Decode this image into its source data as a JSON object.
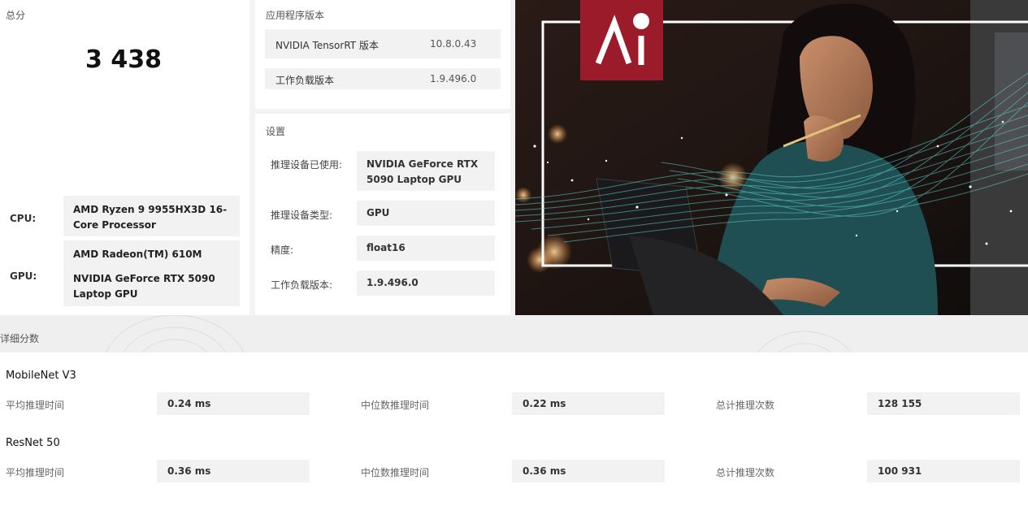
{
  "score": {
    "title": "总分",
    "value": "3 438",
    "cpu_label": "CPU:",
    "cpu_value": "AMD Ryzen 9 9955HX3D 16-Core Processor",
    "gpu_label": "GPU:",
    "gpu_values": [
      "AMD Radeon(TM) 610M",
      "NVIDIA GeForce RTX 5090 Laptop GPU"
    ]
  },
  "app_version": {
    "title": "应用程序版本",
    "rows": [
      {
        "key": "NVIDIA TensorRT 版本",
        "value": "10.8.0.43"
      },
      {
        "key": "工作负载版本",
        "value": "1.9.496.0"
      }
    ]
  },
  "settings": {
    "title": "设置",
    "rows": [
      {
        "key": "推理设备已使用:",
        "value": "NVIDIA GeForce RTX 5090 Laptop GPU"
      },
      {
        "key": "推理设备类型:",
        "value": "GPU"
      },
      {
        "key": "精度:",
        "value": "float16"
      },
      {
        "key": "工作负载版本:",
        "value": "1.9.496.0"
      }
    ]
  },
  "hero": {
    "logo_icon": "ai-logo-icon",
    "brand_color": "#9b1b2b"
  },
  "details": {
    "title": "详细分数",
    "models": [
      {
        "name": "MobileNet V3",
        "avg_label": "平均推理时间",
        "avg_value": "0.24 ms",
        "median_label": "中位数推理时间",
        "median_value": "0.22 ms",
        "count_label": "总计推理次数",
        "count_value": "128 155"
      },
      {
        "name": "ResNet 50",
        "avg_label": "平均推理时间",
        "avg_value": "0.36 ms",
        "median_label": "中位数推理时间",
        "median_value": "0.36 ms",
        "count_label": "总计推理次数",
        "count_value": "100 931"
      }
    ]
  }
}
